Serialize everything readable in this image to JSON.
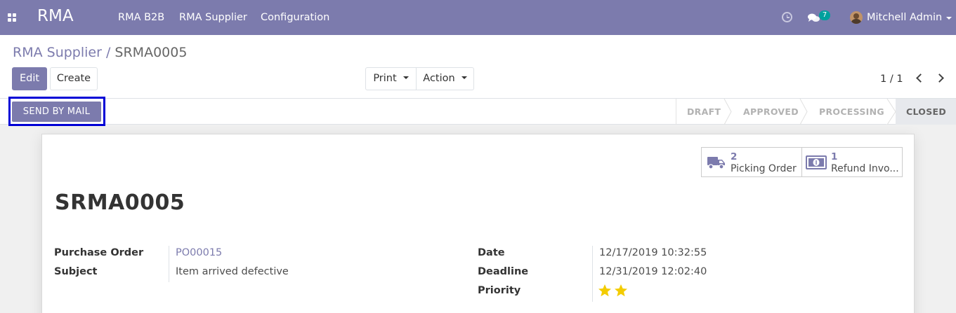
{
  "navbar": {
    "brand": "RMA",
    "menu": [
      "RMA B2B",
      "RMA Supplier",
      "Configuration"
    ],
    "messages_count": "7",
    "user_name": "Mitchell Admin"
  },
  "control_panel": {
    "breadcrumb_parent": "RMA Supplier",
    "breadcrumb_separator": "/",
    "breadcrumb_current": "SRMA0005",
    "edit_label": "Edit",
    "create_label": "Create",
    "print_label": "Print",
    "action_label": "Action",
    "pager": "1 / 1"
  },
  "statusbar": {
    "send_label": "SEND BY MAIL",
    "stages": [
      "DRAFT",
      "APPROVED",
      "PROCESSING",
      "CLOSED"
    ],
    "active_stage": "CLOSED"
  },
  "smart_buttons": [
    {
      "count": "2",
      "label": "Picking Order",
      "icon": "truck-icon"
    },
    {
      "count": "1",
      "label": "Refund Invo...",
      "icon": "money-icon"
    }
  ],
  "record": {
    "name": "SRMA0005",
    "left_fields": [
      {
        "label": "Purchase Order",
        "value": "PO00015",
        "link": true
      },
      {
        "label": "Subject",
        "value": "Item arrived defective",
        "link": false
      }
    ],
    "right_fields": [
      {
        "label": "Date",
        "value": "12/17/2019 10:32:55"
      },
      {
        "label": "Deadline",
        "value": "12/31/2019 12:02:40"
      },
      {
        "label": "Priority",
        "value": ""
      }
    ],
    "priority_stars": 2
  },
  "colors": {
    "brand": "#7c7bad",
    "star": "#f3cc00",
    "highlight": "#0000d6"
  }
}
